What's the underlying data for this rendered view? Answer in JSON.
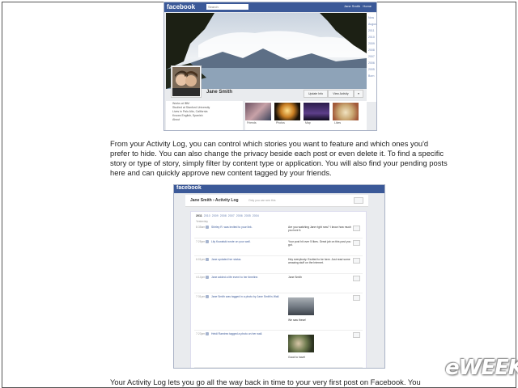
{
  "timeline": {
    "logo": "facebook",
    "search_placeholder": "Search",
    "user": "Jane Smith",
    "home": "Home",
    "profile_name": "Jane Smith",
    "update_info": "Update Info",
    "view_activity": "View Activity",
    "nav_years": [
      "Now",
      "August",
      "2011",
      "2010",
      "2009",
      "2008",
      "2007",
      "2006",
      "2005",
      "Born"
    ],
    "info": [
      "Works at IBM",
      "Studied at Stanford University",
      "Lives in Palo Alto, California",
      "Knows English, Spanish"
    ],
    "about": "About",
    "apps": [
      "Friends",
      "Photos",
      "Map",
      "Likes"
    ]
  },
  "paragraph1": "From your Activity Log, you can control which stories you want to feature and which ones you'd prefer to hide. You can also change the privacy beside each post or even delete it. To find a specific story or type of story, simply filter by content type or application. You will also find your pending posts here and can quickly approve new content tagged by your friends.",
  "activity_log": {
    "logo": "facebook",
    "title": "Jane Smith › Activity Log",
    "privacy_note": "Only you can see this",
    "years": [
      "2011",
      "2010",
      "2009",
      "2008",
      "2007",
      "2006",
      "2005",
      "2004"
    ],
    "section": "Yesterday",
    "rows": [
      {
        "time": "8:35am",
        "action": "Shirley R. was invited to your link.",
        "story": "Are you watching Jane right now? I know how much you love it."
      },
      {
        "time": "7:25pm",
        "action": "Lily Kowalski wrote on your wall.",
        "story": "Your post hit over 5 likes. Great job on this post you got."
      },
      {
        "time": "6:01pm",
        "action": "Jane updated her status.",
        "story": "Hey everybody. Excited to be here. Just read some amazing stuff on the Internet."
      },
      {
        "time": "4:14pm",
        "action": "Jane added a life event to her timeline.",
        "story": "Jane Smith"
      },
      {
        "time": "7:31pm",
        "action": "Jane Smith was tagged in a photo by Jane Smith's Wall.",
        "story": "We saw these!"
      },
      {
        "time": "7:23pm",
        "action": "Heidi Ramirez tagged a photo on her wall.",
        "story": "Good to have!"
      }
    ]
  },
  "paragraph2": "Your Activity Log lets you go all the way back in time to your very first post on Facebook. You",
  "brand": "eWEEK",
  "colors": {
    "facebook_blue": "#3b5998",
    "link_blue": "#6d84b4"
  }
}
